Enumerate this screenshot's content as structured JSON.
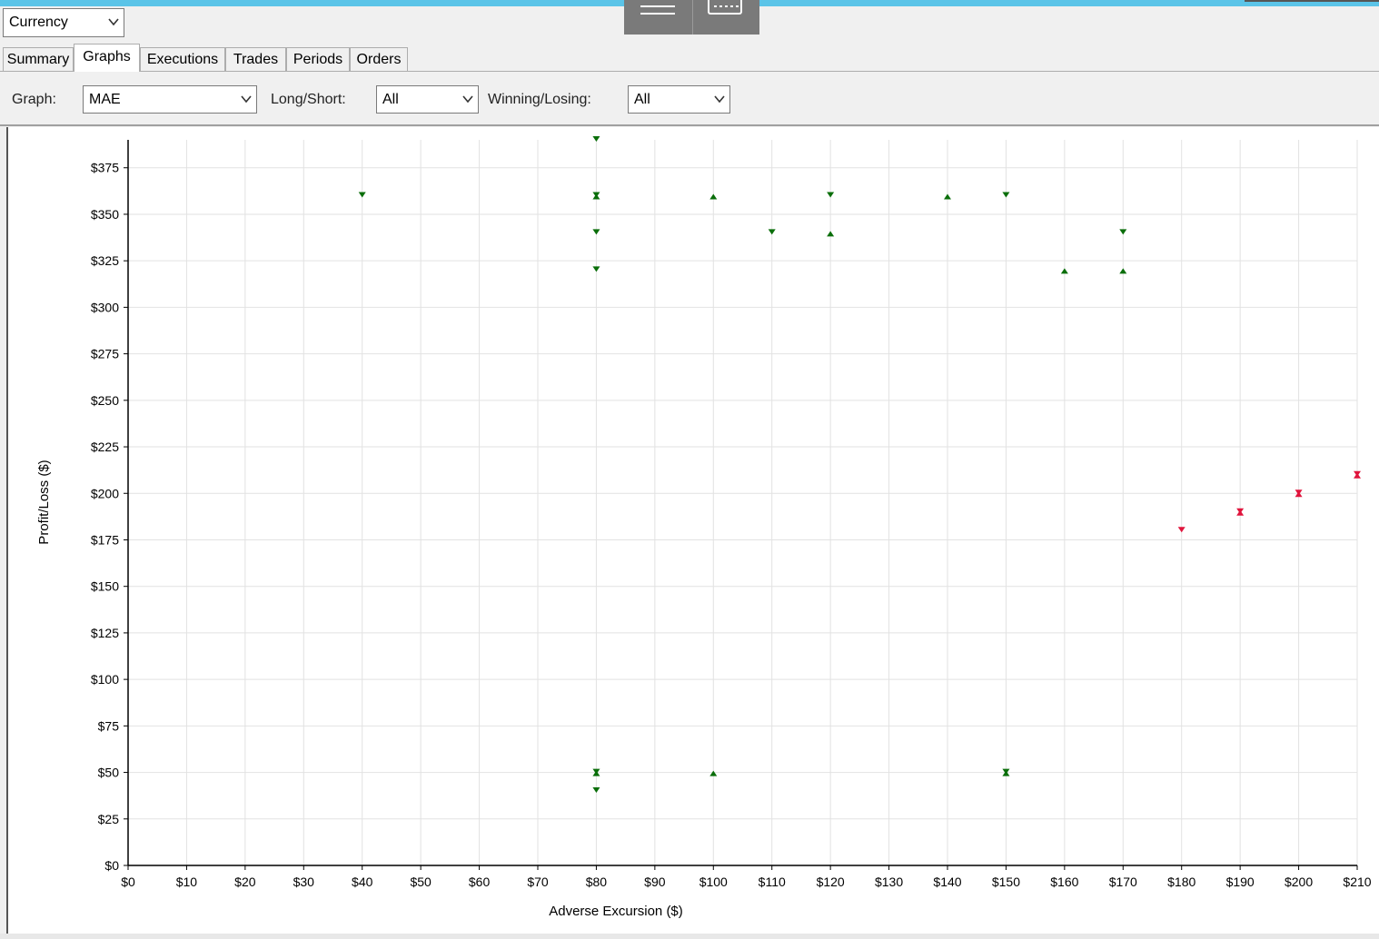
{
  "toolbar": {
    "currency_select": {
      "value": "Currency"
    }
  },
  "tabs": [
    {
      "label": "Summary",
      "active": false
    },
    {
      "label": "Graphs",
      "active": true
    },
    {
      "label": "Executions",
      "active": false
    },
    {
      "label": "Trades",
      "active": false
    },
    {
      "label": "Periods",
      "active": false
    },
    {
      "label": "Orders",
      "active": false
    }
  ],
  "filters": {
    "graph_label": "Graph:",
    "graph_value": "MAE",
    "long_short_label": "Long/Short:",
    "long_short_value": "All",
    "winning_losing_label": "Winning/Losing:",
    "winning_losing_value": "All"
  },
  "colors": {
    "winning": "#0a6e0a",
    "losing": "#e0143c"
  },
  "chart_data": {
    "type": "scatter",
    "xlabel": "Adverse Excursion ($)",
    "ylabel": "Profit/Loss ($)",
    "xlim": [
      0,
      210
    ],
    "ylim": [
      0,
      390
    ],
    "x_ticks": [
      "$0",
      "$10",
      "$20",
      "$30",
      "$40",
      "$50",
      "$60",
      "$70",
      "$80",
      "$90",
      "$100",
      "$110",
      "$120",
      "$130",
      "$140",
      "$150",
      "$160",
      "$170",
      "$180",
      "$190",
      "$200",
      "$210"
    ],
    "y_ticks": [
      "$0",
      "$25",
      "$50",
      "$75",
      "$100",
      "$125",
      "$150",
      "$175",
      "$200",
      "$225",
      "$250",
      "$275",
      "$300",
      "$325",
      "$350",
      "$375"
    ],
    "grid": true,
    "points": [
      {
        "x": 40,
        "y": 360,
        "marker": "down",
        "color": "winning"
      },
      {
        "x": 80,
        "y": 390,
        "marker": "down",
        "color": "winning"
      },
      {
        "x": 80,
        "y": 360,
        "marker": "both",
        "color": "winning"
      },
      {
        "x": 80,
        "y": 340,
        "marker": "down",
        "color": "winning"
      },
      {
        "x": 80,
        "y": 320,
        "marker": "down",
        "color": "winning"
      },
      {
        "x": 100,
        "y": 360,
        "marker": "up",
        "color": "winning"
      },
      {
        "x": 110,
        "y": 340,
        "marker": "down",
        "color": "winning"
      },
      {
        "x": 120,
        "y": 360,
        "marker": "down",
        "color": "winning"
      },
      {
        "x": 120,
        "y": 340,
        "marker": "up",
        "color": "winning"
      },
      {
        "x": 140,
        "y": 360,
        "marker": "up",
        "color": "winning"
      },
      {
        "x": 150,
        "y": 360,
        "marker": "down",
        "color": "winning"
      },
      {
        "x": 160,
        "y": 320,
        "marker": "up",
        "color": "winning"
      },
      {
        "x": 170,
        "y": 340,
        "marker": "down",
        "color": "winning"
      },
      {
        "x": 170,
        "y": 320,
        "marker": "up",
        "color": "winning"
      },
      {
        "x": 80,
        "y": 50,
        "marker": "both",
        "color": "winning"
      },
      {
        "x": 80,
        "y": 40,
        "marker": "down",
        "color": "winning"
      },
      {
        "x": 100,
        "y": 50,
        "marker": "up",
        "color": "winning"
      },
      {
        "x": 150,
        "y": 50,
        "marker": "both",
        "color": "winning"
      },
      {
        "x": 180,
        "y": 180,
        "marker": "down",
        "color": "losing"
      },
      {
        "x": 190,
        "y": 190,
        "marker": "both",
        "color": "losing"
      },
      {
        "x": 200,
        "y": 200,
        "marker": "both",
        "color": "losing"
      },
      {
        "x": 210,
        "y": 210,
        "marker": "both",
        "color": "losing"
      }
    ]
  }
}
